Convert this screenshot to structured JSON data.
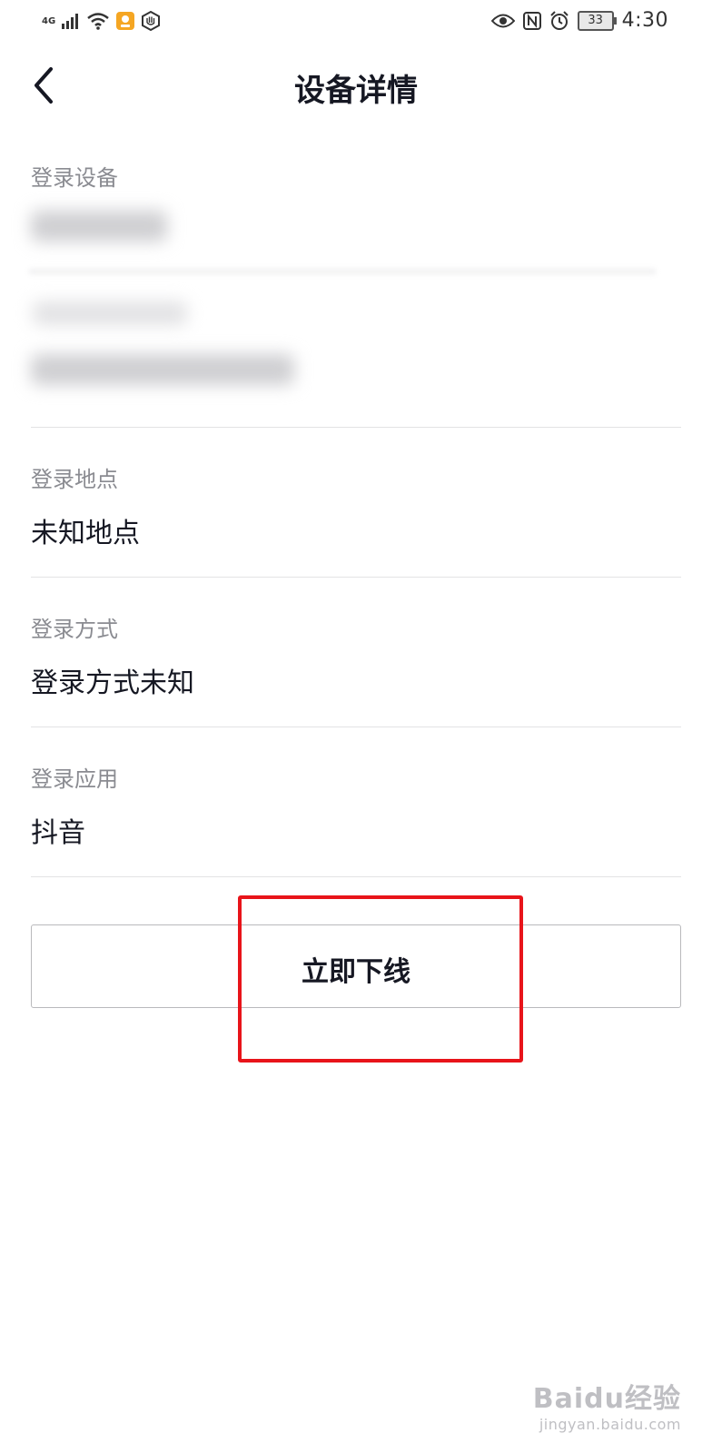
{
  "status_bar": {
    "network": "4G",
    "battery": "33",
    "time": "4:30"
  },
  "header": {
    "title": "设备详情"
  },
  "sections": {
    "device": {
      "label": "登录设备"
    },
    "location": {
      "label": "登录地点",
      "value": "未知地点"
    },
    "method": {
      "label": "登录方式",
      "value": "登录方式未知"
    },
    "app": {
      "label": "登录应用",
      "value": "抖音"
    }
  },
  "actions": {
    "offline_label": "立即下线"
  },
  "annotation": {
    "highlight_color": "#e8141a"
  },
  "watermark": {
    "brand": "Baidu经验",
    "url": "jingyan.baidu.com"
  },
  "colors": {
    "primary_text": "#161823",
    "secondary_text": "#8a8b91",
    "divider": "#e3e3e4"
  }
}
